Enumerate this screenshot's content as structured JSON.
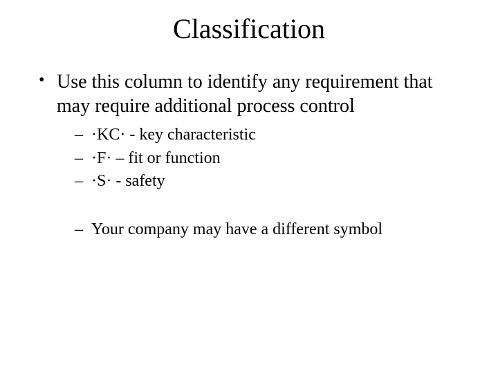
{
  "title": "Classification",
  "bullet_main": "Use this column to identify any requirement that may require additional process control",
  "sub": {
    "kc": "·KC· -  key characteristic",
    "f": "·F· – fit or function",
    "s": "·S· - safety",
    "note": "Your company may have a different symbol"
  }
}
